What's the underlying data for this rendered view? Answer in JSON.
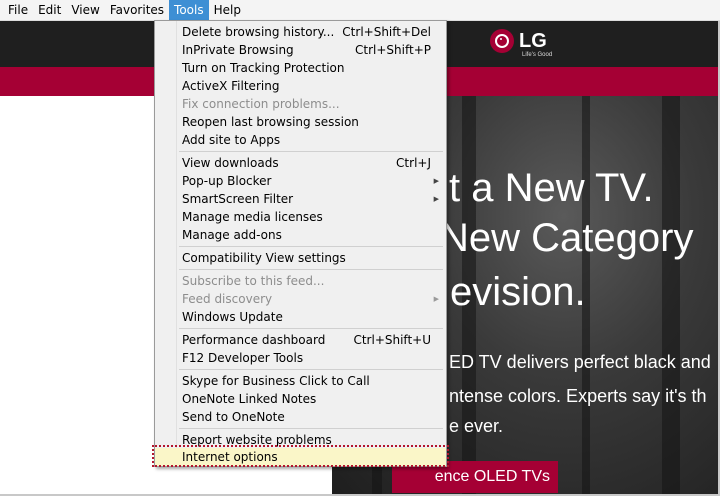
{
  "menubar": {
    "items": [
      "File",
      "Edit",
      "View",
      "Favorites",
      "Tools",
      "Help"
    ],
    "active": "Tools"
  },
  "tools_menu": {
    "items": [
      {
        "label": "Delete browsing history...",
        "shortcut": "Ctrl+Shift+Del"
      },
      {
        "label": "InPrivate Browsing",
        "shortcut": "Ctrl+Shift+P"
      },
      {
        "label": "Turn on Tracking Protection"
      },
      {
        "label": "ActiveX Filtering"
      },
      {
        "label": "Fix connection problems...",
        "disabled": true
      },
      {
        "label": "Reopen last browsing session"
      },
      {
        "label": "Add site to Apps"
      },
      {
        "label": "View downloads",
        "shortcut": "Ctrl+J"
      },
      {
        "label": "Pop-up Blocker",
        "submenu": true
      },
      {
        "label": "SmartScreen Filter",
        "submenu": true
      },
      {
        "label": "Manage media licenses"
      },
      {
        "label": "Manage add-ons"
      },
      {
        "label": "Compatibility View settings"
      },
      {
        "label": "Subscribe to this feed...",
        "disabled": true
      },
      {
        "label": "Feed discovery",
        "disabled": true,
        "submenu": true
      },
      {
        "label": "Windows Update"
      },
      {
        "label": "Performance dashboard",
        "shortcut": "Ctrl+Shift+U"
      },
      {
        "label": "F12 Developer Tools"
      },
      {
        "label": "Skype for Business Click to Call"
      },
      {
        "label": "OneNote Linked Notes"
      },
      {
        "label": "Send to OneNote"
      },
      {
        "label": "Report website problems"
      },
      {
        "label": "Internet options",
        "highlighted": true
      }
    ]
  },
  "page": {
    "logo_text": "LG",
    "logo_tagline": "Life's Good",
    "hero_lines": [
      "t a New TV.",
      "New Category",
      "evision."
    ],
    "hero_body": [
      "ED TV delivers perfect black and",
      "ntense colors. Experts say it's th",
      "e ever."
    ],
    "cta_label": "ence OLED TVs"
  },
  "colors": {
    "menu_active": "#3e8fd4",
    "brand_red": "#a50034",
    "highlight": "#faf6c8",
    "focus_border": "#b3162d"
  }
}
